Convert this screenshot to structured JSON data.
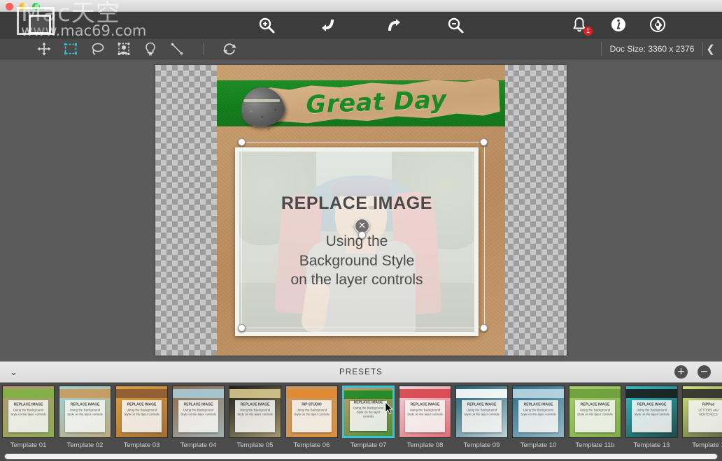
{
  "window": {
    "traffic_lights": [
      "close",
      "minimize",
      "maximize"
    ],
    "watermark_line1": "Mac天空",
    "watermark_line2": "www.mac69.com"
  },
  "toolbar_top": {
    "center_tools": [
      {
        "name": "zoom-in-icon",
        "label": "Zoom In"
      },
      {
        "name": "undo-icon",
        "label": "Undo"
      },
      {
        "name": "redo-icon",
        "label": "Redo"
      },
      {
        "name": "zoom-out-icon",
        "label": "Zoom Out"
      }
    ],
    "right_tools": [
      {
        "name": "notifications-bell-icon",
        "label": "Notifications",
        "badge": "1"
      },
      {
        "name": "info-icon",
        "label": "Info"
      },
      {
        "name": "settings-icon",
        "label": "Settings"
      }
    ]
  },
  "toolbar_tools": {
    "tools": [
      {
        "name": "move-tool",
        "label": "Move",
        "active": false
      },
      {
        "name": "rectangle-select-tool",
        "label": "Rectangle Select",
        "active": true
      },
      {
        "name": "lasso-tool",
        "label": "Lasso",
        "active": false
      },
      {
        "name": "subject-select-tool",
        "label": "Select Subject",
        "active": false
      },
      {
        "name": "magic-tool",
        "label": "Magic / Effects",
        "active": false
      },
      {
        "name": "line-tool",
        "label": "Line",
        "active": false
      },
      {
        "name": "refresh-tool",
        "label": "Refresh",
        "active": false
      }
    ],
    "doc_size_label": "Doc Size: 3360 x 2376",
    "collapse_chevron": "❮"
  },
  "canvas": {
    "banner_text": "Great Day",
    "overlay": {
      "title": "REPLACE IMAGE",
      "line1": "Using the",
      "line2": "Background Style",
      "line3": "on the layer controls",
      "close_glyph": "✕"
    },
    "handles": [
      "top-left",
      "top-right",
      "bottom-left",
      "bottom-right",
      "center"
    ]
  },
  "presets_bar": {
    "title": "PRESETS",
    "collapse_chevron": "⌄",
    "add_glyph": "+",
    "remove_glyph": "−"
  },
  "presets": [
    {
      "label": "Template 01",
      "selected": false,
      "mini_title": "REPLACE IMAGE",
      "mini_body": "Using the Background Style on the layer controls",
      "bg": "#b59877",
      "accent": "#7db343"
    },
    {
      "label": "Template 02",
      "selected": false,
      "mini_title": "REPLACE IMAGE",
      "mini_body": "Using the Background Style on the layer controls",
      "bg": "#9fd3d8",
      "accent": "#c99a5a"
    },
    {
      "label": "Template 03",
      "selected": false,
      "mini_title": "REPLACE IMAGE",
      "mini_body": "Using the Background Style on the layer controls",
      "bg": "#e0a23d",
      "accent": "#8b5a33"
    },
    {
      "label": "Template 04",
      "selected": false,
      "mini_title": "REPLACE IMAGE",
      "mini_body": "Using the Background Style on the layer controls",
      "bg": "#8d6a4f",
      "accent": "#a8cbd6"
    },
    {
      "label": "Template 05",
      "selected": false,
      "mini_title": "REPLACE IMAGE",
      "mini_body": "Using the Background Style on the layer controls",
      "bg": "#1b1b1b",
      "accent": "#d9c98e"
    },
    {
      "label": "Template 06",
      "selected": false,
      "mini_title": "RIP STUDIO",
      "mini_body": "Using the Background Style on the layer controls",
      "bg": "#c59a6b",
      "accent": "#e08a2e"
    },
    {
      "label": "Template 07",
      "selected": true,
      "mini_title": "REPLACE IMAGE",
      "mini_body": "Using the Background Style on the layer controls",
      "bg": "#c49a6c",
      "accent": "#1b8a23"
    },
    {
      "label": "Template 08",
      "selected": false,
      "mini_title": "REPLACE IMAGE",
      "mini_body": "Using the Background Style on the layer controls",
      "bg": "#f0d7de",
      "accent": "#d8424a"
    },
    {
      "label": "Template 09",
      "selected": false,
      "mini_title": "REPLACE IMAGE",
      "mini_body": "Using the Background Style on the layer controls",
      "bg": "#1d5f72",
      "accent": "#ffffff"
    },
    {
      "label": "Template 10",
      "selected": false,
      "mini_title": "REPLACE IMAGE",
      "mini_body": "Using the Background Style on the layer controls",
      "bg": "#2a6c87",
      "accent": "#bcd7e3"
    },
    {
      "label": "Template 11b",
      "selected": false,
      "mini_title": "REPLACE IMAGE",
      "mini_body": "Using the Background Style on the layer controls",
      "bg": "#a8cf6a",
      "accent": "#6d9e3c"
    },
    {
      "label": "Template 13",
      "selected": false,
      "mini_title": "REPLACE IMAGE",
      "mini_body": "Using the Background Style on the layer controls",
      "bg": "#2dc0c8",
      "accent": "#1a1a1a"
    },
    {
      "label": "Template 1",
      "selected": false,
      "mini_title": "RiPPed",
      "mini_body": "LETTERS and SENTENCES",
      "bg": "#d5e47a",
      "accent": "#2b2b2b"
    }
  ],
  "colors": {
    "accent_cyan": "#2ec7dd",
    "badge_red": "#e02020",
    "toolbar_dark": "#3c3c3c",
    "toolbar_mid": "#4a4a4a",
    "canvas_bg": "#5b5b5b",
    "banner_green": "#1b8a23"
  }
}
